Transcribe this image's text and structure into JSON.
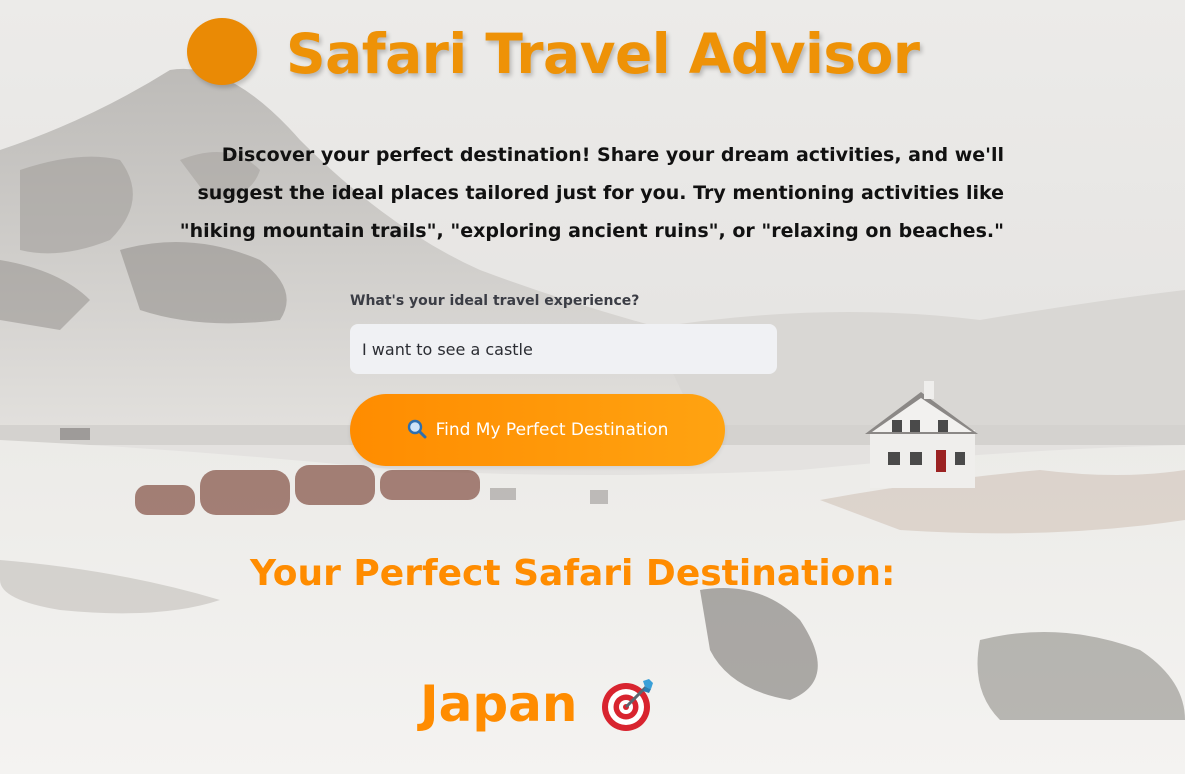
{
  "app": {
    "title": "Safari Travel Advisor",
    "logo_icon": "orange-circle-logo-icon",
    "accent_color": "#ff8c00"
  },
  "intro": {
    "text": "Discover your perfect destination! Share your dream activities, and we'll suggest the ideal places tailored just for you. Try mentioning activities like \"hiking mountain trails\", \"exploring ancient ruins\", or \"relaxing on beaches.\""
  },
  "form": {
    "label": "What's your ideal travel experience?",
    "input_value": "I want to see a castle",
    "button_icon": "magnifying-glass-icon",
    "button_label": "Find My Perfect Destination"
  },
  "result": {
    "heading": "Your Perfect Safari Destination:",
    "destination": "Japan",
    "destination_icon": "direct-hit-target-icon"
  }
}
